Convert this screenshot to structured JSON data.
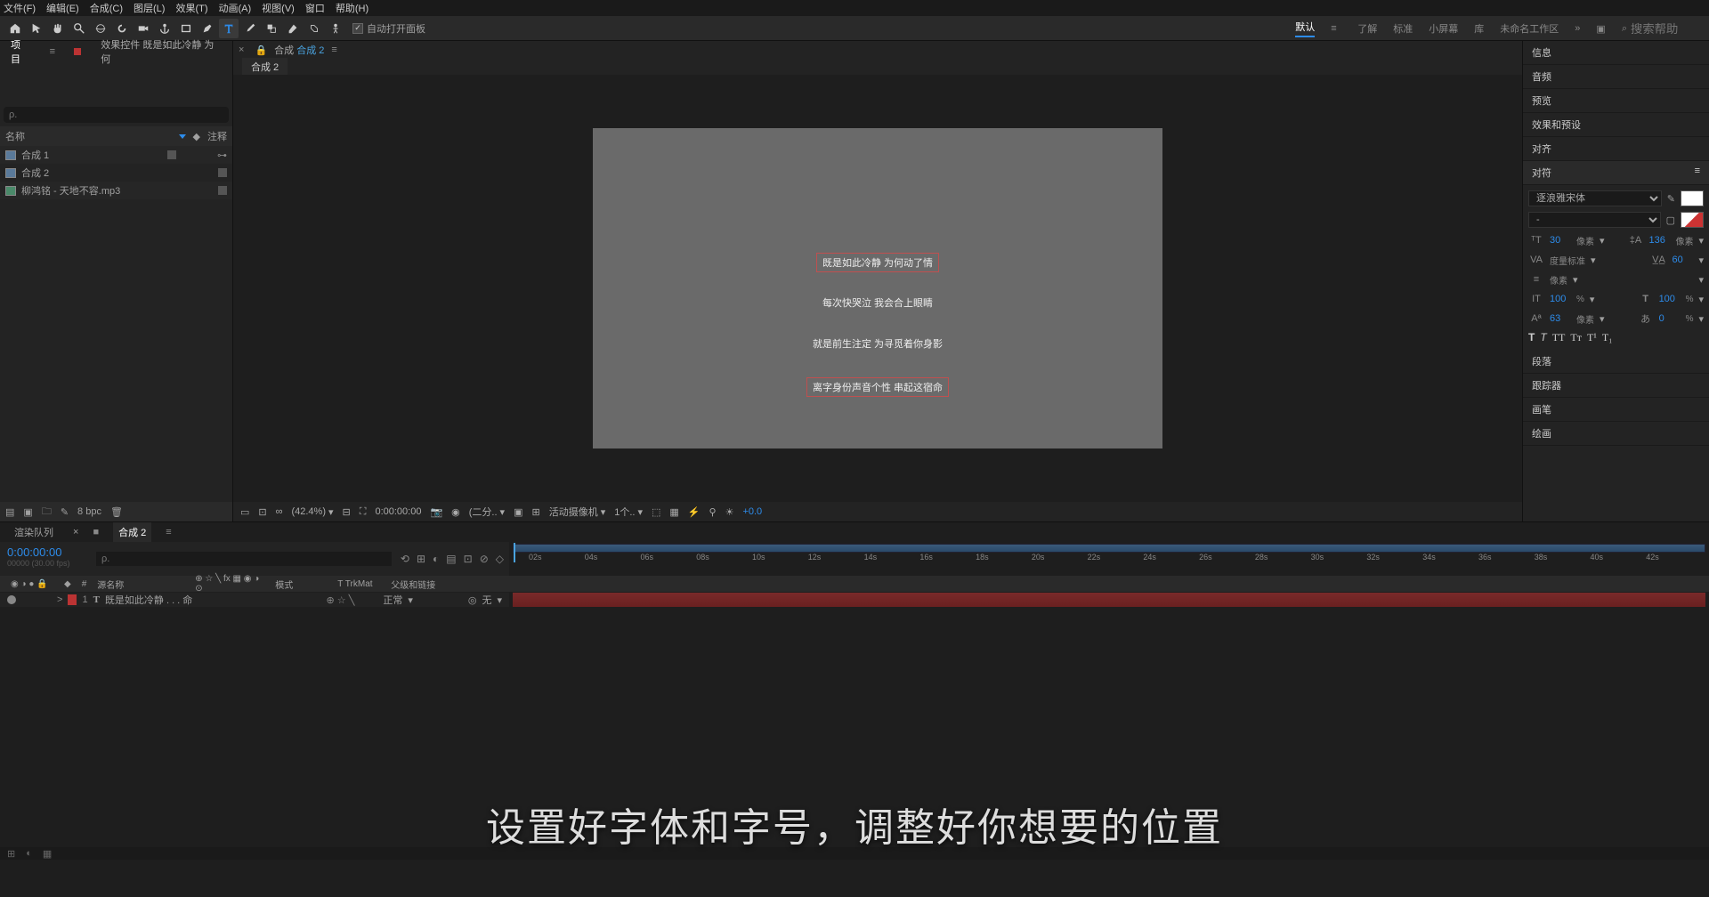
{
  "menu": {
    "file": "文件(F)",
    "edit": "编辑(E)",
    "comp": "合成(C)",
    "layer": "图层(L)",
    "effect": "效果(T)",
    "anim": "动画(A)",
    "view": "视图(V)",
    "window": "窗口",
    "help": "帮助(H)"
  },
  "toolbar": {
    "autoOpen": "自动打开面板"
  },
  "workspace": {
    "default": "默认",
    "learn": "了解",
    "standard": "标准",
    "small": "小屏幕",
    "lib": "库",
    "unnamed": "未命名工作区",
    "searchPH": "搜索帮助"
  },
  "project": {
    "tab": "项目",
    "fxTab": "效果控件 既是如此冷静 为何",
    "searchPH": "ρ.",
    "colName": "名称",
    "colComment": "注释",
    "items": [
      {
        "name": "合成 1"
      },
      {
        "name": "合成 2"
      },
      {
        "name": "柳鸿铭 - 天地不容.mp3"
      }
    ],
    "bpc": "8 bpc"
  },
  "comp": {
    "prefix": "合成",
    "name": "合成 2",
    "tab": "合成 2"
  },
  "lyrics": {
    "l1": "既是如此冷静 为何动了情",
    "l2": "每次快哭泣 我会合上眼睛",
    "l3": "就是前生注定 为寻觅着你身影",
    "l4": "离字身份声音个性 串起这宿命"
  },
  "viewerFoot": {
    "zoom": "(42.4%)",
    "time": "0:00:00:00",
    "res": "(二分..",
    "cam": "活动摄像机",
    "views": "1个..",
    "exp": "+0.0"
  },
  "rightPanels": {
    "info": "信息",
    "audio": "音频",
    "preview": "预览",
    "fx": "效果和预设",
    "align": "对齐",
    "char": "对符",
    "para": "段落",
    "track": "跟踪器",
    "brush": "画笔",
    "paint": "绘画"
  },
  "char": {
    "font": "逐浪雅宋体",
    "style": "-",
    "size": "30",
    "sizeU": "像素",
    "lead": "136",
    "leadU": "像素",
    "track": "度量标准",
    "trackN": "60",
    "kern": "像素",
    "sx": "100",
    "sxU": "%",
    "sy": "100",
    "syU": "%",
    "base": "63",
    "baseU": "像素",
    "tsu": "0",
    "tsuU": "%"
  },
  "timeline": {
    "renderQ": "渲染队列",
    "compTab": "合成 2",
    "time": "0:00:00:00",
    "frame": "00000 (30.00 fps)",
    "searchPH": "ρ.",
    "cols": {
      "src": "源名称",
      "mode": "模式",
      "trk": "TrkMat",
      "parent": "父级和链接"
    },
    "layer": {
      "num": "1",
      "name": "既是如此冷静 . . . 命",
      "mode": "正常",
      "parent": "无"
    },
    "ticks": [
      "02s",
      "04s",
      "06s",
      "08s",
      "10s",
      "12s",
      "14s",
      "16s",
      "18s",
      "20s",
      "22s",
      "24s",
      "26s",
      "28s",
      "30s",
      "32s",
      "34s",
      "36s",
      "38s",
      "40s",
      "42s"
    ]
  },
  "caption": "设置好字体和字号，调整好你想要的位置",
  "icons": {
    "hamburger": "≡",
    "magnify": "⌕",
    "dropdown": "▾",
    "chevron": ">",
    "folder": "🗀",
    "trash": "🗑",
    "eye": "👁"
  }
}
